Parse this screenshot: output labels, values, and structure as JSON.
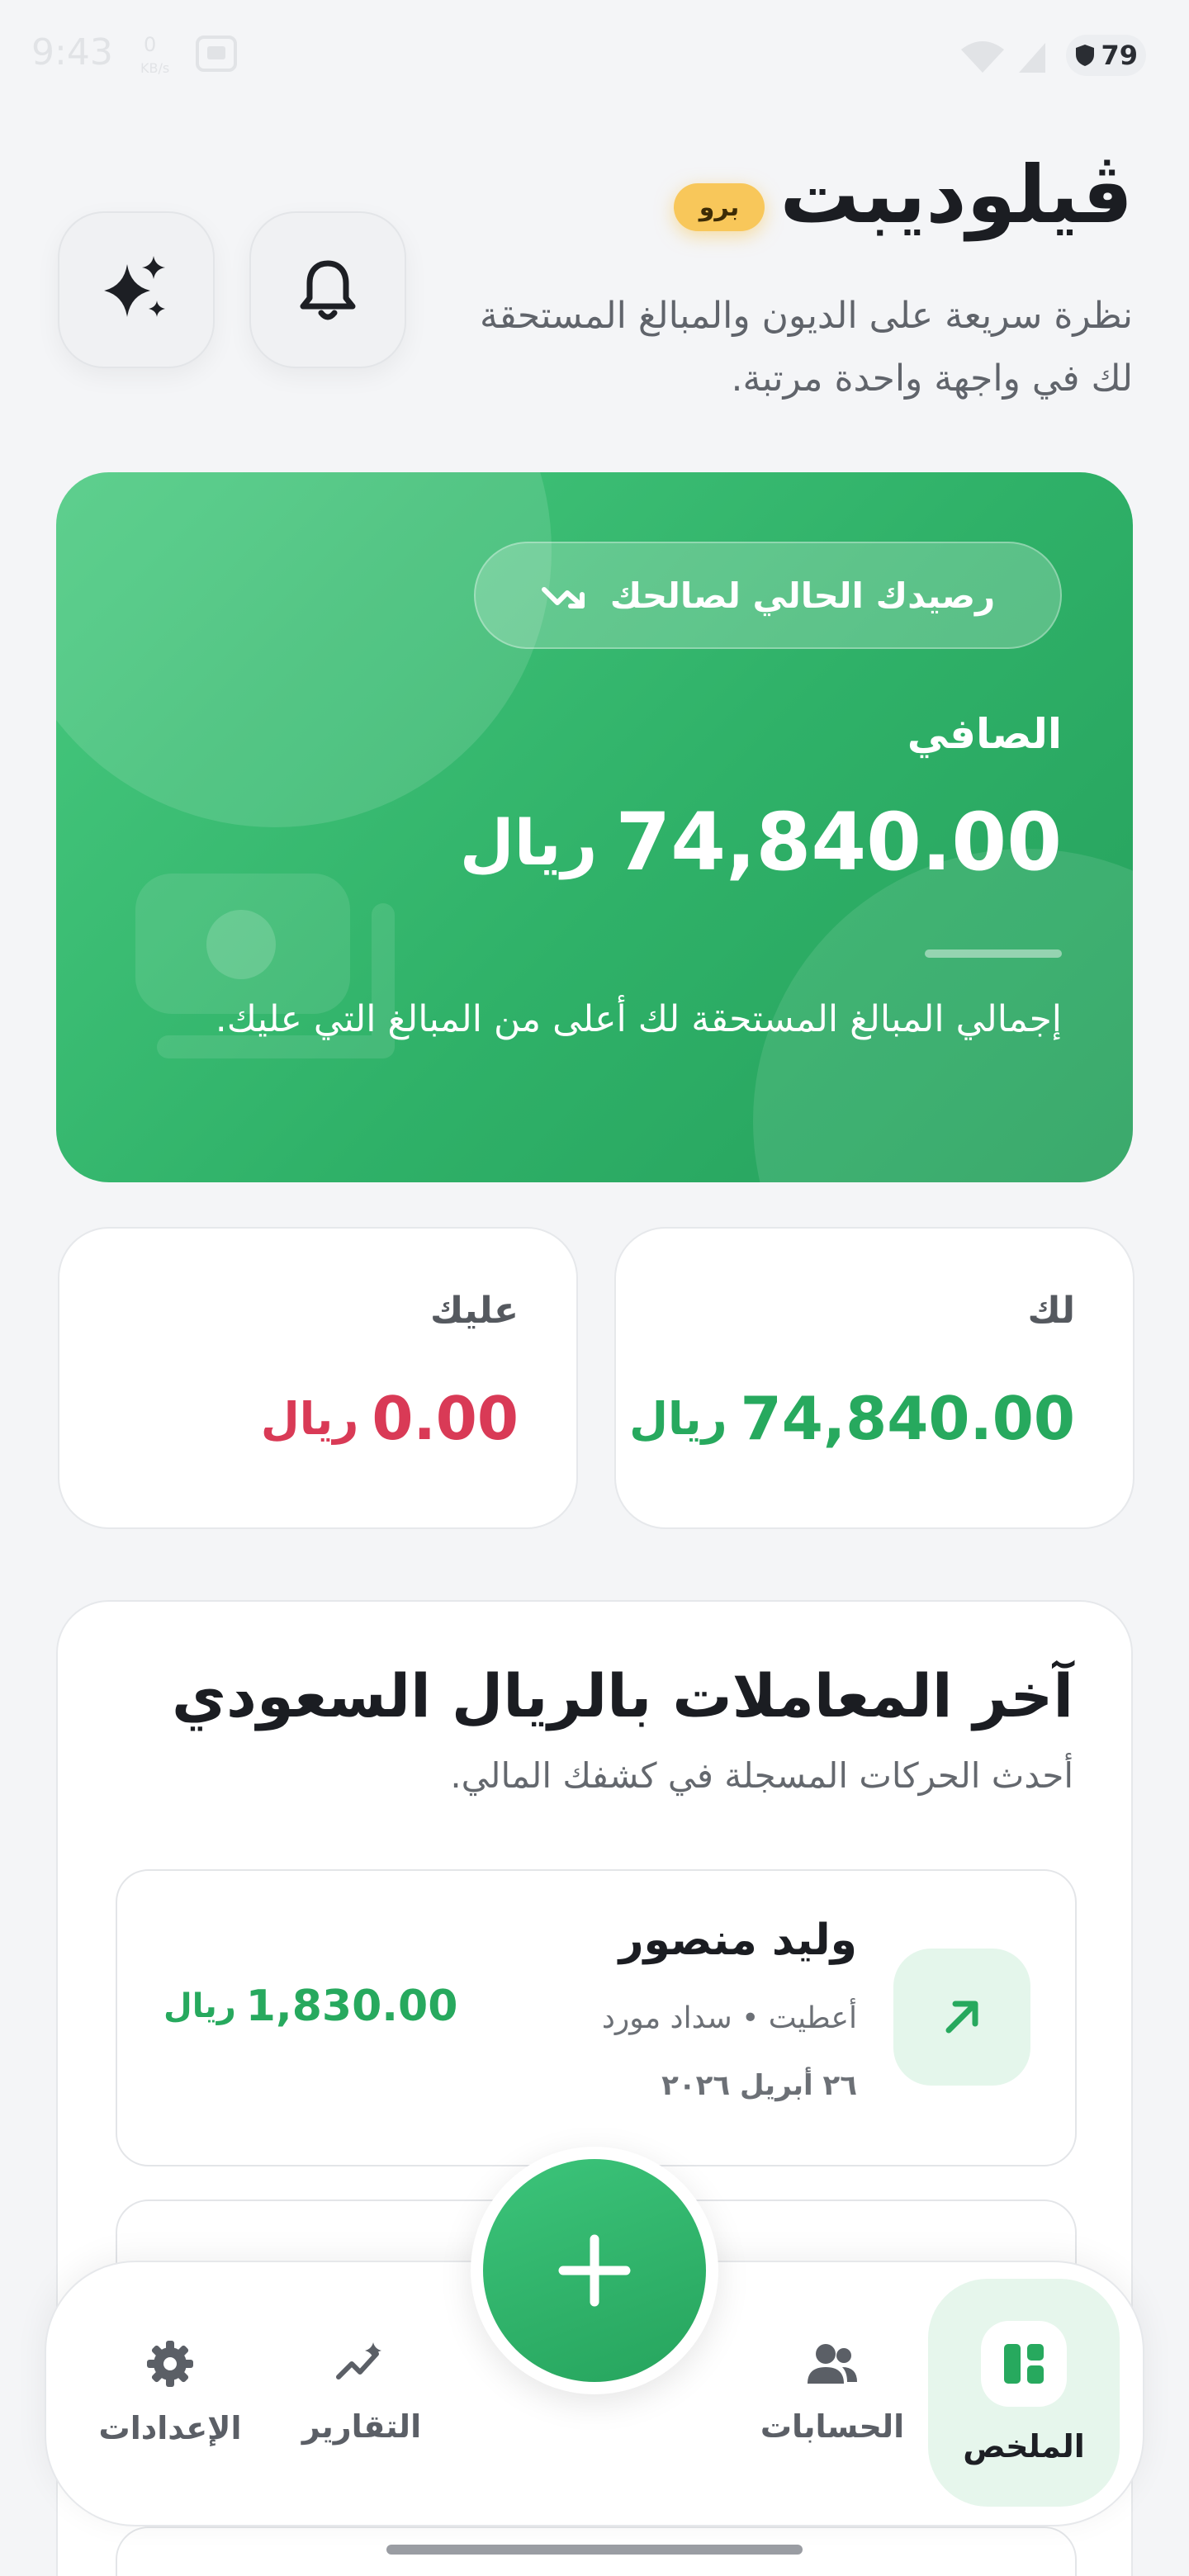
{
  "status_bar": {
    "time": "9:43",
    "battery": "79"
  },
  "header": {
    "app_name": "ڤيلوديبت",
    "badge": "برو",
    "subtitle": "نظرة سريعة على الديون والمبالغ المستحقة لك في واجهة واحدة مرتبة.",
    "icons": [
      "bell-icon",
      "sparkles-icon"
    ]
  },
  "hero": {
    "pill_label": "رصيدك الحالي لصالحك",
    "label": "الصافي",
    "amount": "74,840.00",
    "currency": "ريال",
    "note": "إجمالي المبالغ المستحقة لك أعلى من المبالغ التي عليك.",
    "gradient": [
      "#48c97f",
      "#25a05c"
    ]
  },
  "summary": {
    "owed_to_you": {
      "label": "لك",
      "amount": "74,840.00",
      "currency": "ريال",
      "color": "#27a95e"
    },
    "you_owe": {
      "label": "عليك",
      "amount": "0.00",
      "currency": "ريال",
      "color": "#d93a56"
    }
  },
  "transactions": {
    "title": "آخر المعاملات بالريال السعودي",
    "subtitle": "أحدث الحركات المسجلة في كشفك المالي.",
    "items": [
      {
        "name": "وليد منصور",
        "description": "أعطيت • سداد مورد",
        "date": "٢٦ أبريل ٢٠٢٦",
        "amount": "1,830.00",
        "currency": "ريال",
        "icon": "arrow-up-right-icon"
      }
    ]
  },
  "bottom_nav": {
    "items": [
      {
        "label": "الملخص",
        "icon": "dashboard-icon",
        "active": true
      },
      {
        "label": "الحسابات",
        "icon": "users-icon",
        "active": false
      },
      {
        "label": "التقارير",
        "icon": "chart-sparkle-icon",
        "active": false
      },
      {
        "label": "الإعدادات",
        "icon": "gear-icon",
        "active": false
      }
    ],
    "fab_icon": "plus-icon"
  },
  "colors": {
    "accent": "#2fb168",
    "negative": "#d93a56",
    "background": "#f4f5f7"
  }
}
